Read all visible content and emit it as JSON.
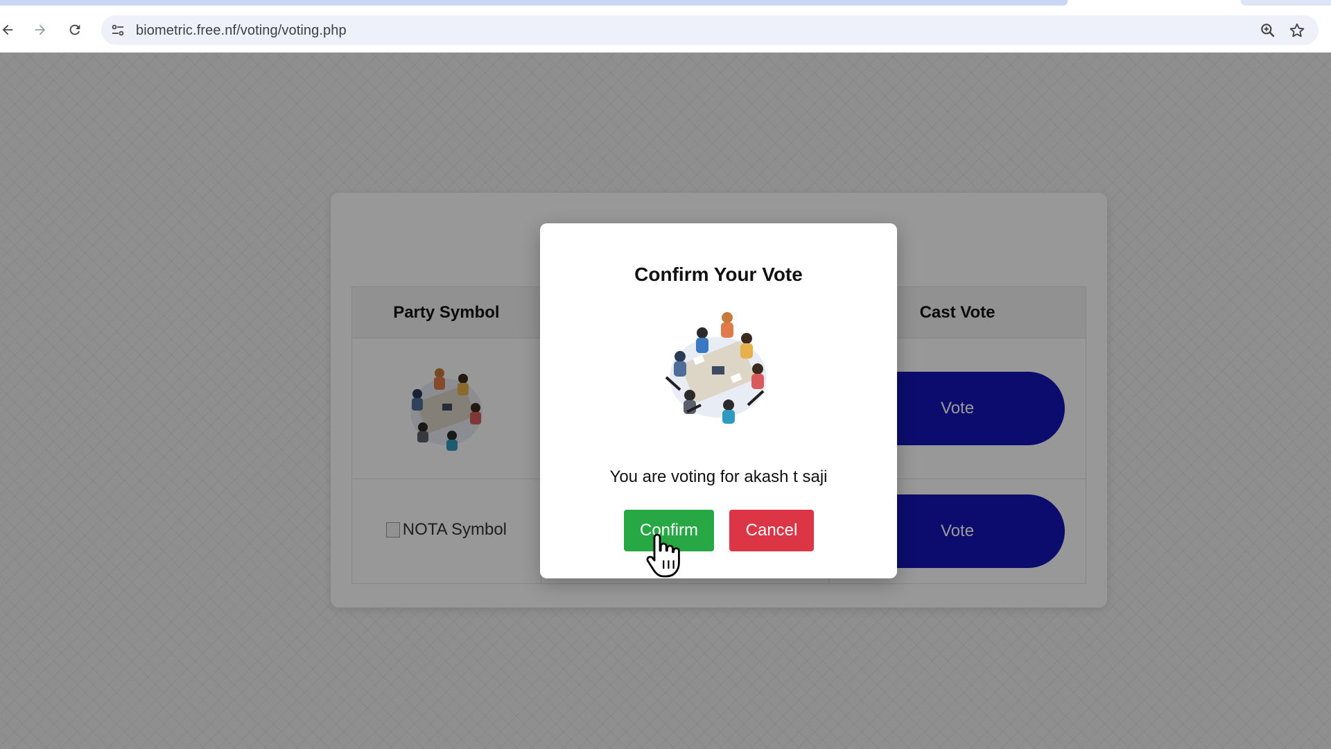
{
  "browser": {
    "url": "biometric.free.nf/voting/voting.php",
    "icons": [
      "back-icon",
      "forward-icon",
      "reload-icon",
      "site-info-icon",
      "zoom-icon",
      "bookmark-star-icon"
    ]
  },
  "table": {
    "headers": {
      "symbol": "Party Symbol",
      "vote": "Cast Vote"
    },
    "rows": [
      {
        "symbol_type": "illustration",
        "vote_label": "Vote"
      },
      {
        "symbol_alt": "NOTA Symbol",
        "vote_label": "Vote"
      }
    ]
  },
  "modal": {
    "title": "Confirm Your Vote",
    "message": "You are voting for akash t saji",
    "confirm_label": "Confirm",
    "cancel_label": "Cancel"
  },
  "colors": {
    "vote_button": "#1515b8",
    "confirm_button": "#28a745",
    "cancel_button": "#dc3545"
  }
}
